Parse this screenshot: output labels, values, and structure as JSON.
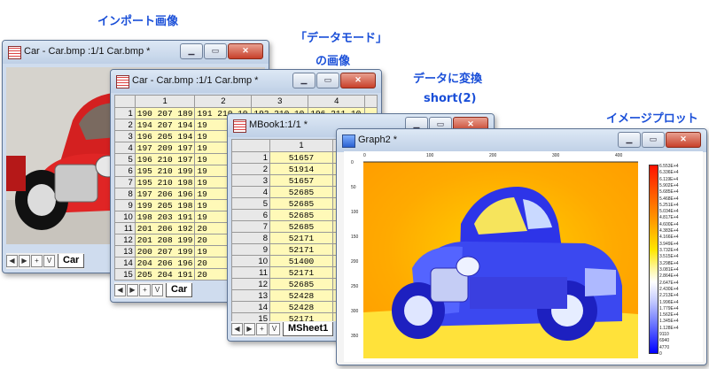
{
  "captions": {
    "import": "インポート画像",
    "datamode_line1": "「データモード」",
    "datamode_line2": "の画像",
    "convert_line1": "データに変換",
    "convert_line2": "short(2)",
    "plot": "イメージプロット"
  },
  "win_image": {
    "title": "Car - Car.bmp :1/1 Car.bmp *",
    "tab": "Car"
  },
  "win_data": {
    "title": "Car - Car.bmp :1/1 Car.bmp *",
    "columns": [
      "1",
      "2",
      "3",
      "4"
    ],
    "rows": [
      {
        "n": "1",
        "c1": "190 207 189",
        "c2": "191 210 10",
        "c3": "192 210 10",
        "c4": "196 211 10"
      },
      {
        "n": "2",
        "c1": "194 207 194",
        "c2": "19",
        "c3": "",
        "c4": ""
      },
      {
        "n": "3",
        "c1": "196 205 194",
        "c2": "19",
        "c3": "",
        "c4": ""
      },
      {
        "n": "4",
        "c1": "197 209 197",
        "c2": "19",
        "c3": "",
        "c4": ""
      },
      {
        "n": "5",
        "c1": "196 210 197",
        "c2": "19",
        "c3": "",
        "c4": ""
      },
      {
        "n": "6",
        "c1": "195 210 199",
        "c2": "19",
        "c3": "",
        "c4": ""
      },
      {
        "n": "7",
        "c1": "195 210 198",
        "c2": "19",
        "c3": "",
        "c4": ""
      },
      {
        "n": "8",
        "c1": "197 206 196",
        "c2": "19",
        "c3": "",
        "c4": ""
      },
      {
        "n": "9",
        "c1": "199 205 198",
        "c2": "19",
        "c3": "",
        "c4": ""
      },
      {
        "n": "10",
        "c1": "198 203 191",
        "c2": "19",
        "c3": "",
        "c4": ""
      },
      {
        "n": "11",
        "c1": "201 206 192",
        "c2": "20",
        "c3": "",
        "c4": ""
      },
      {
        "n": "12",
        "c1": "201 208 199",
        "c2": "20",
        "c3": "",
        "c4": ""
      },
      {
        "n": "13",
        "c1": "200 207 199",
        "c2": "19",
        "c3": "",
        "c4": ""
      },
      {
        "n": "14",
        "c1": "204 206 196",
        "c2": "20",
        "c3": "",
        "c4": ""
      },
      {
        "n": "15",
        "c1": "205 204 191",
        "c2": "20",
        "c3": "",
        "c4": ""
      }
    ],
    "tab": "Car"
  },
  "win_book": {
    "title": "MBook1:1/1 *",
    "column": "1",
    "rows": [
      {
        "n": "1",
        "v": "51657"
      },
      {
        "n": "2",
        "v": "51914"
      },
      {
        "n": "3",
        "v": "51657"
      },
      {
        "n": "4",
        "v": "52685"
      },
      {
        "n": "5",
        "v": "52685"
      },
      {
        "n": "6",
        "v": "52685"
      },
      {
        "n": "7",
        "v": "52685"
      },
      {
        "n": "8",
        "v": "52171"
      },
      {
        "n": "9",
        "v": "52171"
      },
      {
        "n": "10",
        "v": "51400"
      },
      {
        "n": "11",
        "v": "52171"
      },
      {
        "n": "12",
        "v": "52685"
      },
      {
        "n": "13",
        "v": "52428"
      },
      {
        "n": "14",
        "v": "52428"
      },
      {
        "n": "15",
        "v": "52171"
      }
    ],
    "tab": "MSheet1"
  },
  "win_graph": {
    "title": "Graph2 *",
    "layer": "1",
    "x_ticks": [
      "0",
      "100",
      "200",
      "300",
      "400"
    ],
    "y_ticks": [
      "0",
      "50",
      "100",
      "150",
      "200",
      "250",
      "300",
      "350"
    ],
    "scale_labels": [
      "6.553E+4",
      "6.336E+4",
      "6.119E+4",
      "5.902E+4",
      "5.685E+4",
      "5.468E+4",
      "5.251E+4",
      "5.034E+4",
      "4.817E+4",
      "4.600E+4",
      "4.383E+4",
      "4.166E+4",
      "3.949E+4",
      "3.732E+4",
      "3.515E+4",
      "3.298E+4",
      "3.081E+4",
      "2.864E+4",
      "2.647E+4",
      "2.430E+4",
      "2.213E+4",
      "1.996E+4",
      "1.779E+4",
      "1.562E+4",
      "1.345E+4",
      "1.128E+4",
      "9110",
      "6940",
      "4770",
      "0"
    ],
    "colors": {
      "high": "#ff1200",
      "mid": "#fff200",
      "low": "#0000ff"
    }
  }
}
